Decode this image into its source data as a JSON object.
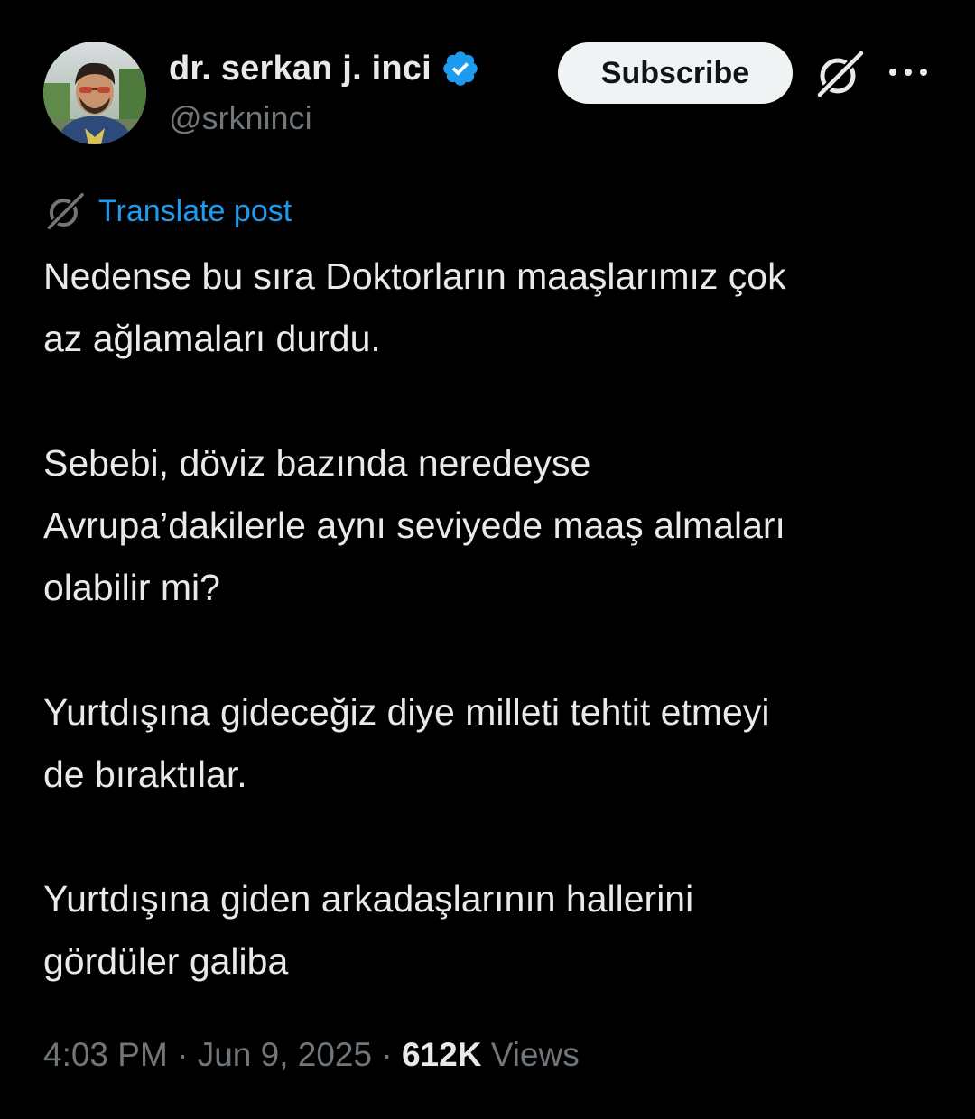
{
  "author": {
    "display_name": "dr. serkan j. inci",
    "handle": "@srkninci",
    "verified_icon": "verified-badge-icon",
    "avatar_icon": "avatar"
  },
  "actions": {
    "subscribe_label": "Subscribe",
    "grok_icon": "grok-icon",
    "more_icon": "more-options-icon"
  },
  "translate": {
    "label": "Translate post",
    "icon": "grok-icon"
  },
  "post": {
    "paragraphs": [
      "Nedense bu sıra Doktorların maaşlarımız çok\naz ağlamaları durdu.",
      "Sebebi, döviz bazında neredeyse\nAvrupa’dakilerle aynı seviyede maaş almaları\nolabilir mi?",
      "Yurtdışına gideceğiz diye milleti tehtit etmeyi\nde bıraktılar.",
      "Yurtdışına giden arkadaşlarının hallerini\ngördüler galiba"
    ]
  },
  "meta": {
    "time": "4:03 PM",
    "separator": "·",
    "date": "Jun 9, 2025",
    "views_count": "612K",
    "views_label": "Views"
  },
  "colors": {
    "background": "#000000",
    "text": "#e7e9ea",
    "secondary": "#71767b",
    "accent": "#1d9bf0",
    "button_bg": "#eff3f4"
  }
}
